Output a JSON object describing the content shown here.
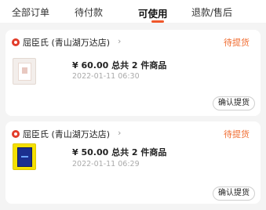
{
  "tabs": [
    {
      "label": "全部订单"
    },
    {
      "label": "待付款"
    },
    {
      "label": "可使用"
    },
    {
      "label": "退款/售后"
    }
  ],
  "orders": [
    {
      "shop": "屈臣氏 (青山湖万达店)",
      "status": "待提货",
      "price_summary": "¥ 60.00 总共 2 件商品",
      "time": "2022-01-11 06:30",
      "action": "确认提货"
    },
    {
      "shop": "屈臣氏 (青山湖万达店)",
      "status": "待提货",
      "price_summary": "¥ 50.00 总共 2 件商品",
      "time": "2022-01-11 06:29",
      "action": "确认提货"
    }
  ],
  "icons": {
    "shop": "store-icon",
    "chevron": "chevron-right-icon"
  },
  "colors": {
    "accent": "#f06b2f",
    "shop_icon": "#e23d2b"
  }
}
